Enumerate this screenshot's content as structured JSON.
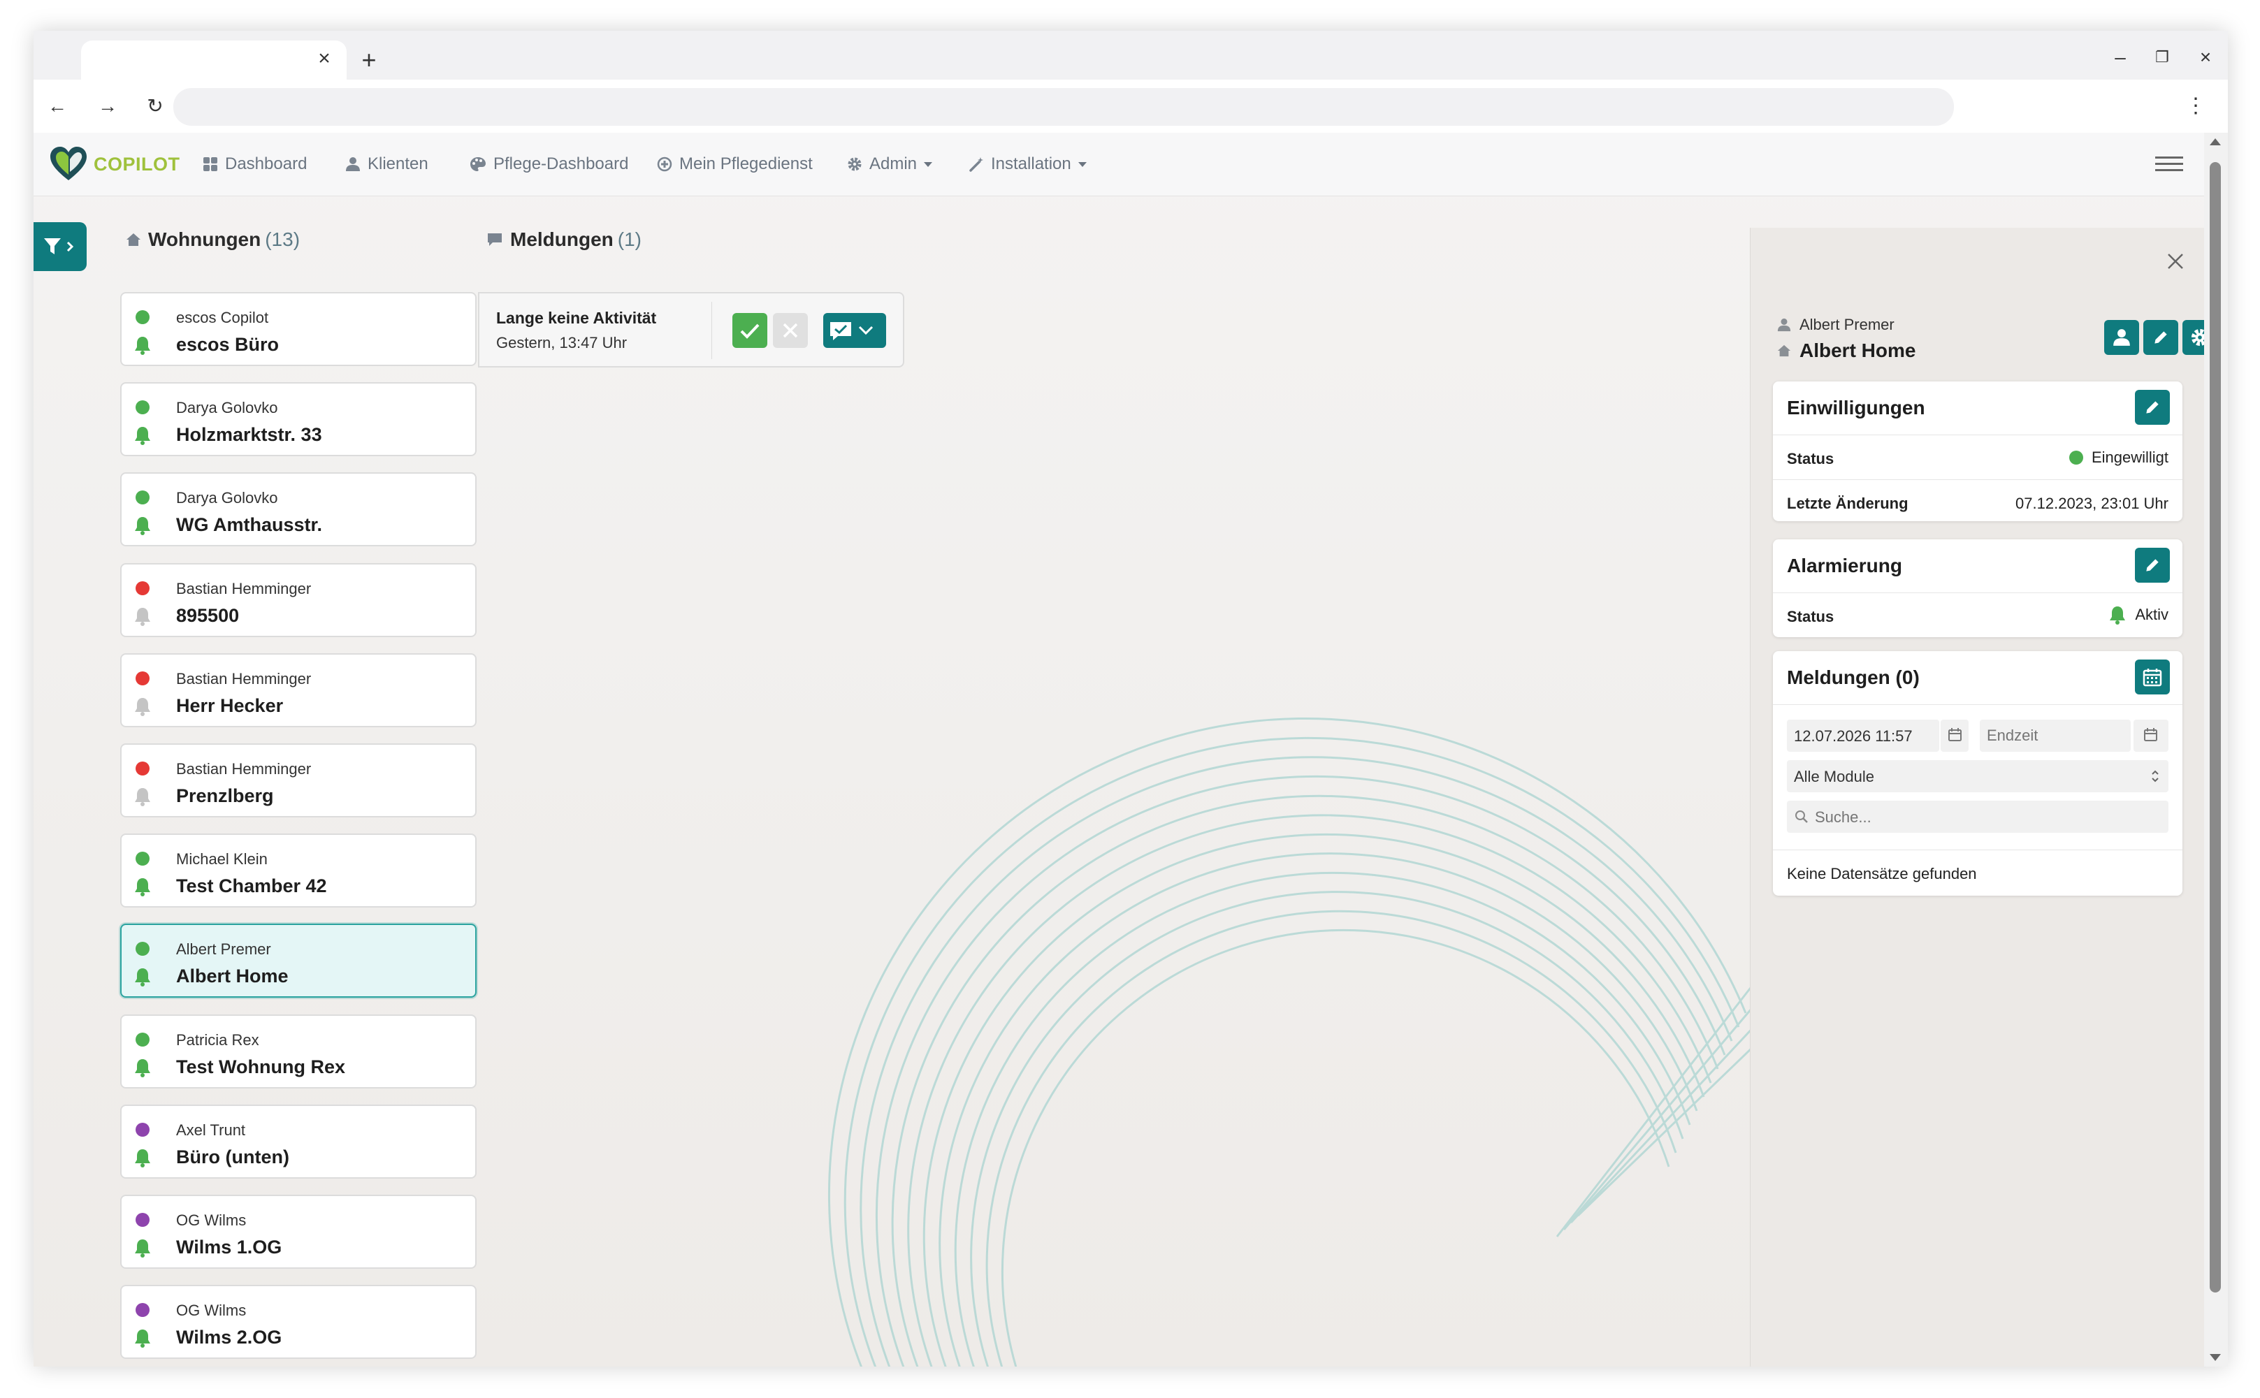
{
  "browser": {
    "tab_close": "×",
    "new_tab": "+",
    "back": "←",
    "forward": "→",
    "reload": "↻",
    "menu": "⋮",
    "minimize": "–",
    "restore": "❐",
    "close": "×"
  },
  "nav": {
    "logo_text": "COPILOT",
    "items": [
      {
        "label": "Dashboard",
        "icon": "dashboard-icon"
      },
      {
        "label": "Klienten",
        "icon": "user-icon"
      },
      {
        "label": "Pflege-Dashboard",
        "icon": "palette-icon"
      },
      {
        "label": "Mein Pflegedienst",
        "icon": "plus-circle-icon"
      },
      {
        "label": "Admin",
        "icon": "gear-icon"
      },
      {
        "label": "Installation",
        "icon": "wand-icon"
      }
    ]
  },
  "wohnungen": {
    "title": "Wohnungen",
    "count": "(13)",
    "items": [
      {
        "resident": "escos Copilot",
        "name": "escos Büro",
        "status_color": "#4caf50",
        "alarm": "active"
      },
      {
        "resident": "Darya Golovko",
        "name": "Holzmarktstr. 33",
        "status_color": "#4caf50",
        "alarm": "active"
      },
      {
        "resident": "Darya Golovko",
        "name": "WG Amthausstr.",
        "status_color": "#4caf50",
        "alarm": "active"
      },
      {
        "resident": "Bastian Hemminger",
        "name": "895500",
        "status_color": "#e53935",
        "alarm": "inactive"
      },
      {
        "resident": "Bastian Hemminger",
        "name": "Herr Hecker",
        "status_color": "#e53935",
        "alarm": "inactive"
      },
      {
        "resident": "Bastian Hemminger",
        "name": "Prenzlberg",
        "status_color": "#e53935",
        "alarm": "inactive"
      },
      {
        "resident": "Michael Klein",
        "name": "Test Chamber 42",
        "status_color": "#4caf50",
        "alarm": "active"
      },
      {
        "resident": "Albert Premer",
        "name": "Albert Home",
        "status_color": "#4caf50",
        "alarm": "active",
        "selected": true
      },
      {
        "resident": "Patricia Rex",
        "name": "Test Wohnung Rex",
        "status_color": "#4caf50",
        "alarm": "active"
      },
      {
        "resident": "Axel Trunt",
        "name": "Büro (unten)",
        "status_color": "#8e44ad",
        "alarm": "active"
      },
      {
        "resident": "OG Wilms",
        "name": "Wilms 1.OG",
        "status_color": "#8e44ad",
        "alarm": "active"
      },
      {
        "resident": "OG Wilms",
        "name": "Wilms 2.OG",
        "status_color": "#8e44ad",
        "alarm": "active"
      }
    ]
  },
  "meldungen": {
    "title": "Meldungen",
    "count": "(1)",
    "item": {
      "title": "Lange keine Aktivität",
      "time": "Gestern, 13:47 Uhr"
    }
  },
  "panel": {
    "person": "Albert Premer",
    "home": "Albert Home",
    "einwilligungen": {
      "title": "Einwilligungen",
      "status_label": "Status",
      "status_value": "Eingewilligt",
      "change_label": "Letzte Änderung",
      "change_value": "07.12.2023, 23:01 Uhr"
    },
    "alarmierung": {
      "title": "Alarmierung",
      "status_label": "Status",
      "status_value": "Aktiv"
    },
    "meldungen": {
      "title": "Meldungen (0)",
      "start_value": "12.07.2026 11:57",
      "end_placeholder": "Endzeit",
      "module_value": "Alle Module",
      "search_placeholder": "Suche...",
      "empty_text": "Keine Datensätze gefunden"
    }
  },
  "colors": {
    "accent": "#0f7b7e",
    "ok": "#4caf50",
    "alarm_active": "#4caf50",
    "alarm_inactive": "#c4c4c4",
    "logo": "#9fc13c"
  }
}
